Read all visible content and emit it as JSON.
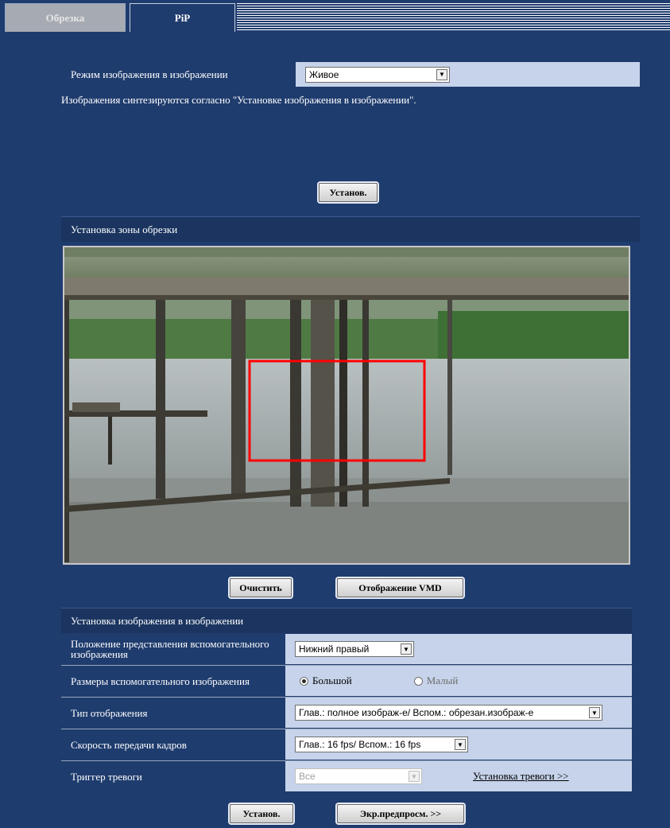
{
  "tabs": [
    {
      "label": "Обрезка",
      "active": false
    },
    {
      "label": "PiP",
      "active": true
    }
  ],
  "mode": {
    "label": "Режим изображения в изображении",
    "value": "Живое",
    "description": "Изображения синтезируются согласно \"Установке изображения в изображении\"."
  },
  "set_button_top": "Установ.",
  "crop_section": {
    "title": "Установка зоны обрезки",
    "clear_button": "Очистить",
    "vmd_button": "Отображение VMD"
  },
  "pip_section": {
    "title": "Установка изображения в изображении",
    "position": {
      "label": "Положение представления вспомогательного изображения",
      "value": "Нижний правый"
    },
    "size": {
      "label": "Размеры вспомогательного изображения",
      "options": [
        "Большой",
        "Малый"
      ],
      "selected": "Большой"
    },
    "display_type": {
      "label": "Тип отображения",
      "value": "Глав.: полное изображ-е/ Вспом.: обрезан.изображ-е"
    },
    "frame_rate": {
      "label": "Скорость передачи кадров",
      "value": "Глав.: 16 fps/ Вспом.: 16 fps"
    },
    "alarm_trigger": {
      "label": "Триггер тревоги",
      "value": "Все",
      "link": "Установка тревоги >>"
    }
  },
  "bottom": {
    "set_button": "Установ.",
    "preview_button": "Экр.предпросм. >>"
  },
  "colors": {
    "background": "#1f3c6e",
    "value_cell": "#c6d3ea",
    "crop_rect": "#ff0000"
  }
}
